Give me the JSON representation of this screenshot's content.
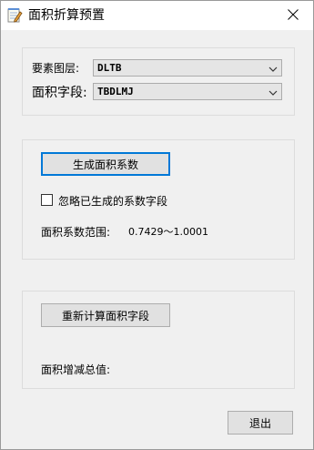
{
  "window": {
    "title": "面积折算预置",
    "app_icon": "notepad-edit-icon",
    "close_icon": "close-icon"
  },
  "layer_group": {
    "layer_label": "要素图层:",
    "layer_value": "DLTB",
    "field_label": "面积字段:",
    "field_value": "TBDLMJ"
  },
  "coef_group": {
    "generate_button": "生成面积系数",
    "ignore_checkbox_label": "忽略已生成的系数字段",
    "ignore_checked": false,
    "range_label": "面积系数范围:",
    "range_value": "0.7429～1.0001"
  },
  "recalc_group": {
    "recalc_button": "重新计算面积字段",
    "total_label": "面积增减总值:",
    "total_value": ""
  },
  "footer": {
    "exit_button": "退出"
  },
  "colors": {
    "focus_border": "#0078d7",
    "window_bg": "#f0f0f0"
  }
}
